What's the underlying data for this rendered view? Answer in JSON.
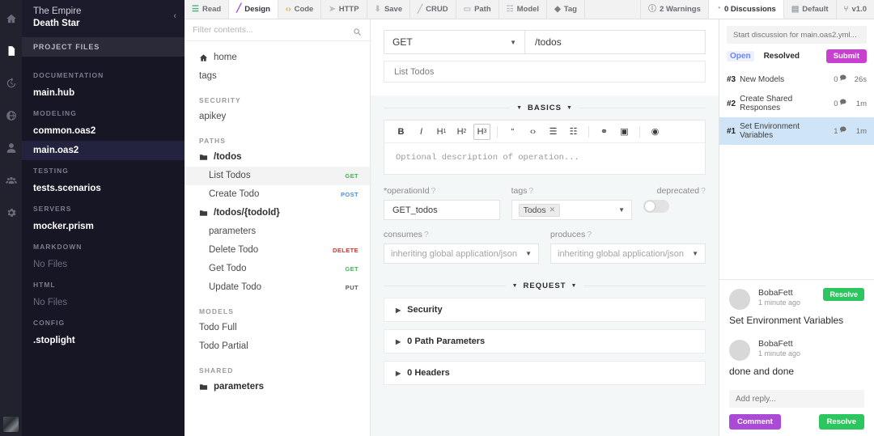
{
  "rail": {
    "items": [
      {
        "name": "home-icon",
        "active": false
      },
      {
        "name": "files-icon",
        "active": true
      },
      {
        "name": "history-icon",
        "active": false
      },
      {
        "name": "globe-icon",
        "active": false
      },
      {
        "name": "user-icon",
        "active": false
      },
      {
        "name": "team-icon",
        "active": false
      },
      {
        "name": "gear-icon",
        "active": false
      }
    ]
  },
  "sidebar": {
    "org": "The Empire",
    "project": "Death Star",
    "collapse_glyph": "‹",
    "section_title": "PROJECT FILES",
    "groups": [
      {
        "label": "DOCUMENTATION",
        "files": [
          {
            "name": "main.hub",
            "muted": false,
            "selected": false
          }
        ]
      },
      {
        "label": "MODELING",
        "files": [
          {
            "name": "common.oas2",
            "muted": false,
            "selected": false
          },
          {
            "name": "main.oas2",
            "muted": false,
            "selected": true
          }
        ]
      },
      {
        "label": "TESTING",
        "files": [
          {
            "name": "tests.scenarios",
            "muted": false,
            "selected": false
          }
        ]
      },
      {
        "label": "SERVERS",
        "files": [
          {
            "name": "mocker.prism",
            "muted": false,
            "selected": false
          }
        ]
      },
      {
        "label": "MARKDOWN",
        "files": [
          {
            "name": "No Files",
            "muted": true,
            "selected": false
          }
        ]
      },
      {
        "label": "HTML",
        "files": [
          {
            "name": "No Files",
            "muted": true,
            "selected": false
          }
        ]
      },
      {
        "label": "CONFIG",
        "files": [
          {
            "name": ".stoplight",
            "muted": false,
            "selected": false
          }
        ]
      }
    ]
  },
  "toolbar": {
    "left": [
      {
        "label": "Read",
        "icon": "book-icon",
        "glyph": "☰",
        "color": "#4caf7d",
        "active": false
      },
      {
        "label": "Design",
        "icon": "brush-icon",
        "glyph": "╱",
        "color": "#9b3fd4",
        "active": true
      },
      {
        "label": "Code",
        "icon": "code-icon",
        "glyph": "‹›",
        "color": "#e8a33d",
        "active": false
      },
      {
        "label": "HTTP",
        "icon": "send-icon",
        "glyph": "➤",
        "color": "#b9bcc2",
        "active": false
      },
      {
        "label": "Save",
        "icon": "save-icon",
        "glyph": "⬇",
        "color": "#b9bcc2",
        "active": false
      },
      {
        "label": "CRUD",
        "icon": "wand-icon",
        "glyph": "╱",
        "color": "#b9bcc2",
        "active": false
      },
      {
        "label": "Path",
        "icon": "path-icon",
        "glyph": "▭",
        "color": "#b9bcc2",
        "active": false
      },
      {
        "label": "Model",
        "icon": "model-icon",
        "glyph": "☷",
        "color": "#b9bcc2",
        "active": false
      },
      {
        "label": "Tag",
        "icon": "tag-icon",
        "glyph": "◆",
        "color": "#7d8087",
        "active": false
      }
    ],
    "right": [
      {
        "label": "2 Warnings",
        "icon": "warning-icon",
        "glyph": "ⓘ",
        "active": false
      },
      {
        "label": "0 Discussions",
        "icon": "comment-icon",
        "glyph": "◔",
        "active": true
      },
      {
        "label": "Default",
        "icon": "layers-icon",
        "glyph": "▤",
        "active": false
      },
      {
        "label": "v1.0",
        "icon": "branch-icon",
        "glyph": "⑂",
        "active": false
      }
    ]
  },
  "tree": {
    "filter_placeholder": "Filter contents...",
    "filter_value": "",
    "rows": [
      {
        "kind": "item",
        "label": "home",
        "icon": "home-icon",
        "verb": "",
        "indent": 0,
        "selected": false,
        "bold": false
      },
      {
        "kind": "item",
        "label": "tags",
        "icon": "",
        "verb": "",
        "indent": 0,
        "selected": false,
        "bold": false
      },
      {
        "kind": "group",
        "label": "SECURITY"
      },
      {
        "kind": "item",
        "label": "apikey",
        "icon": "",
        "verb": "",
        "indent": 0,
        "selected": false,
        "bold": false
      },
      {
        "kind": "group",
        "label": "PATHS"
      },
      {
        "kind": "item",
        "label": "/todos",
        "icon": "folder-icon",
        "verb": "",
        "indent": 0,
        "selected": false,
        "bold": true
      },
      {
        "kind": "item",
        "label": "List Todos",
        "icon": "",
        "verb": "GET",
        "verb_class": "get",
        "indent": 1,
        "selected": true,
        "bold": false
      },
      {
        "kind": "item",
        "label": "Create Todo",
        "icon": "",
        "verb": "POST",
        "verb_class": "post",
        "indent": 1,
        "selected": false,
        "bold": false
      },
      {
        "kind": "item",
        "label": "/todos/{todoId}",
        "icon": "folder-icon",
        "verb": "",
        "indent": 0,
        "selected": false,
        "bold": true
      },
      {
        "kind": "item",
        "label": "parameters",
        "icon": "",
        "verb": "",
        "indent": 1,
        "selected": false,
        "bold": false
      },
      {
        "kind": "item",
        "label": "Delete Todo",
        "icon": "",
        "verb": "DELETE",
        "verb_class": "delete",
        "indent": 1,
        "selected": false,
        "bold": false
      },
      {
        "kind": "item",
        "label": "Get Todo",
        "icon": "",
        "verb": "GET",
        "verb_class": "get",
        "indent": 1,
        "selected": false,
        "bold": false
      },
      {
        "kind": "item",
        "label": "Update Todo",
        "icon": "",
        "verb": "PUT",
        "verb_class": "put",
        "indent": 1,
        "selected": false,
        "bold": false
      },
      {
        "kind": "group",
        "label": "MODELS"
      },
      {
        "kind": "item",
        "label": "Todo Full",
        "icon": "",
        "verb": "",
        "indent": 0,
        "selected": false,
        "bold": false
      },
      {
        "kind": "item",
        "label": "Todo Partial",
        "icon": "",
        "verb": "",
        "indent": 0,
        "selected": false,
        "bold": false
      },
      {
        "kind": "group",
        "label": "SHARED"
      },
      {
        "kind": "item",
        "label": "parameters",
        "icon": "folder-icon",
        "verb": "",
        "indent": 0,
        "selected": false,
        "bold": true
      }
    ]
  },
  "editor": {
    "method": "GET",
    "path": "/todos",
    "summary": "List Todos",
    "basics_label": "BASICS",
    "request_label": "REQUEST",
    "markdown_tools": [
      {
        "name": "bold-icon",
        "glyph": "B",
        "style": "bold",
        "boxed": false
      },
      {
        "name": "italic-icon",
        "glyph": "I",
        "style": "italic",
        "boxed": false
      },
      {
        "name": "heading1-icon",
        "glyph": "H",
        "sub": "1",
        "boxed": false
      },
      {
        "name": "heading2-icon",
        "glyph": "H",
        "sub": "2",
        "boxed": false
      },
      {
        "name": "heading3-icon",
        "glyph": "H",
        "sub": "3",
        "boxed": true
      },
      {
        "name": "sep",
        "glyph": "",
        "boxed": false
      },
      {
        "name": "quote-icon",
        "glyph": "“",
        "boxed": false
      },
      {
        "name": "code-icon",
        "glyph": "‹›",
        "boxed": false
      },
      {
        "name": "bullet-list-icon",
        "glyph": "☰",
        "boxed": false
      },
      {
        "name": "numbered-list-icon",
        "glyph": "☷",
        "boxed": false
      },
      {
        "name": "sep",
        "glyph": "",
        "boxed": false
      },
      {
        "name": "link-icon",
        "glyph": "⚭",
        "boxed": false
      },
      {
        "name": "image-icon",
        "glyph": "▣",
        "boxed": false
      },
      {
        "name": "sep",
        "glyph": "",
        "boxed": false
      },
      {
        "name": "preview-icon",
        "glyph": "◉",
        "boxed": false
      }
    ],
    "description_placeholder": "Optional description of operation...",
    "operation_id_label": "*operationId",
    "operation_id_value": "GET_todos",
    "tags_label": "tags",
    "tags_chip": "Todos",
    "deprecated_label": "deprecated",
    "deprecated_on": false,
    "consumes_label": "consumes",
    "consumes_value": "inheriting global application/json",
    "produces_label": "produces",
    "produces_value": "inheriting global application/json",
    "accordions": [
      {
        "label": "Security"
      },
      {
        "label": "0 Path Parameters"
      },
      {
        "label": "0 Headers"
      }
    ]
  },
  "discussions": {
    "new_placeholder": "Start discussion for main.oas2.yml...",
    "tab_open": "Open",
    "tab_resolved": "Resolved",
    "submit_label": "Submit",
    "items": [
      {
        "num": "#3",
        "title": "New Models",
        "count": "0",
        "age": "26s",
        "active": false
      },
      {
        "num": "#2",
        "title": "Create Shared Responses",
        "count": "0",
        "age": "1m",
        "active": false
      },
      {
        "num": "#1",
        "title": "Set Environment Variables",
        "count": "1",
        "age": "1m",
        "active": true
      }
    ],
    "thread": {
      "messages": [
        {
          "author": "BobaFett",
          "time": "1 minute ago",
          "body": "Set Environment Variables",
          "resolve_label": "Resolve",
          "show_resolve": true
        },
        {
          "author": "BobaFett",
          "time": "1 minute ago",
          "body": "done and done",
          "resolve_label": "",
          "show_resolve": false
        }
      ]
    },
    "reply_placeholder": "Add reply...",
    "comment_label": "Comment",
    "resolve_label": "Resolve"
  }
}
